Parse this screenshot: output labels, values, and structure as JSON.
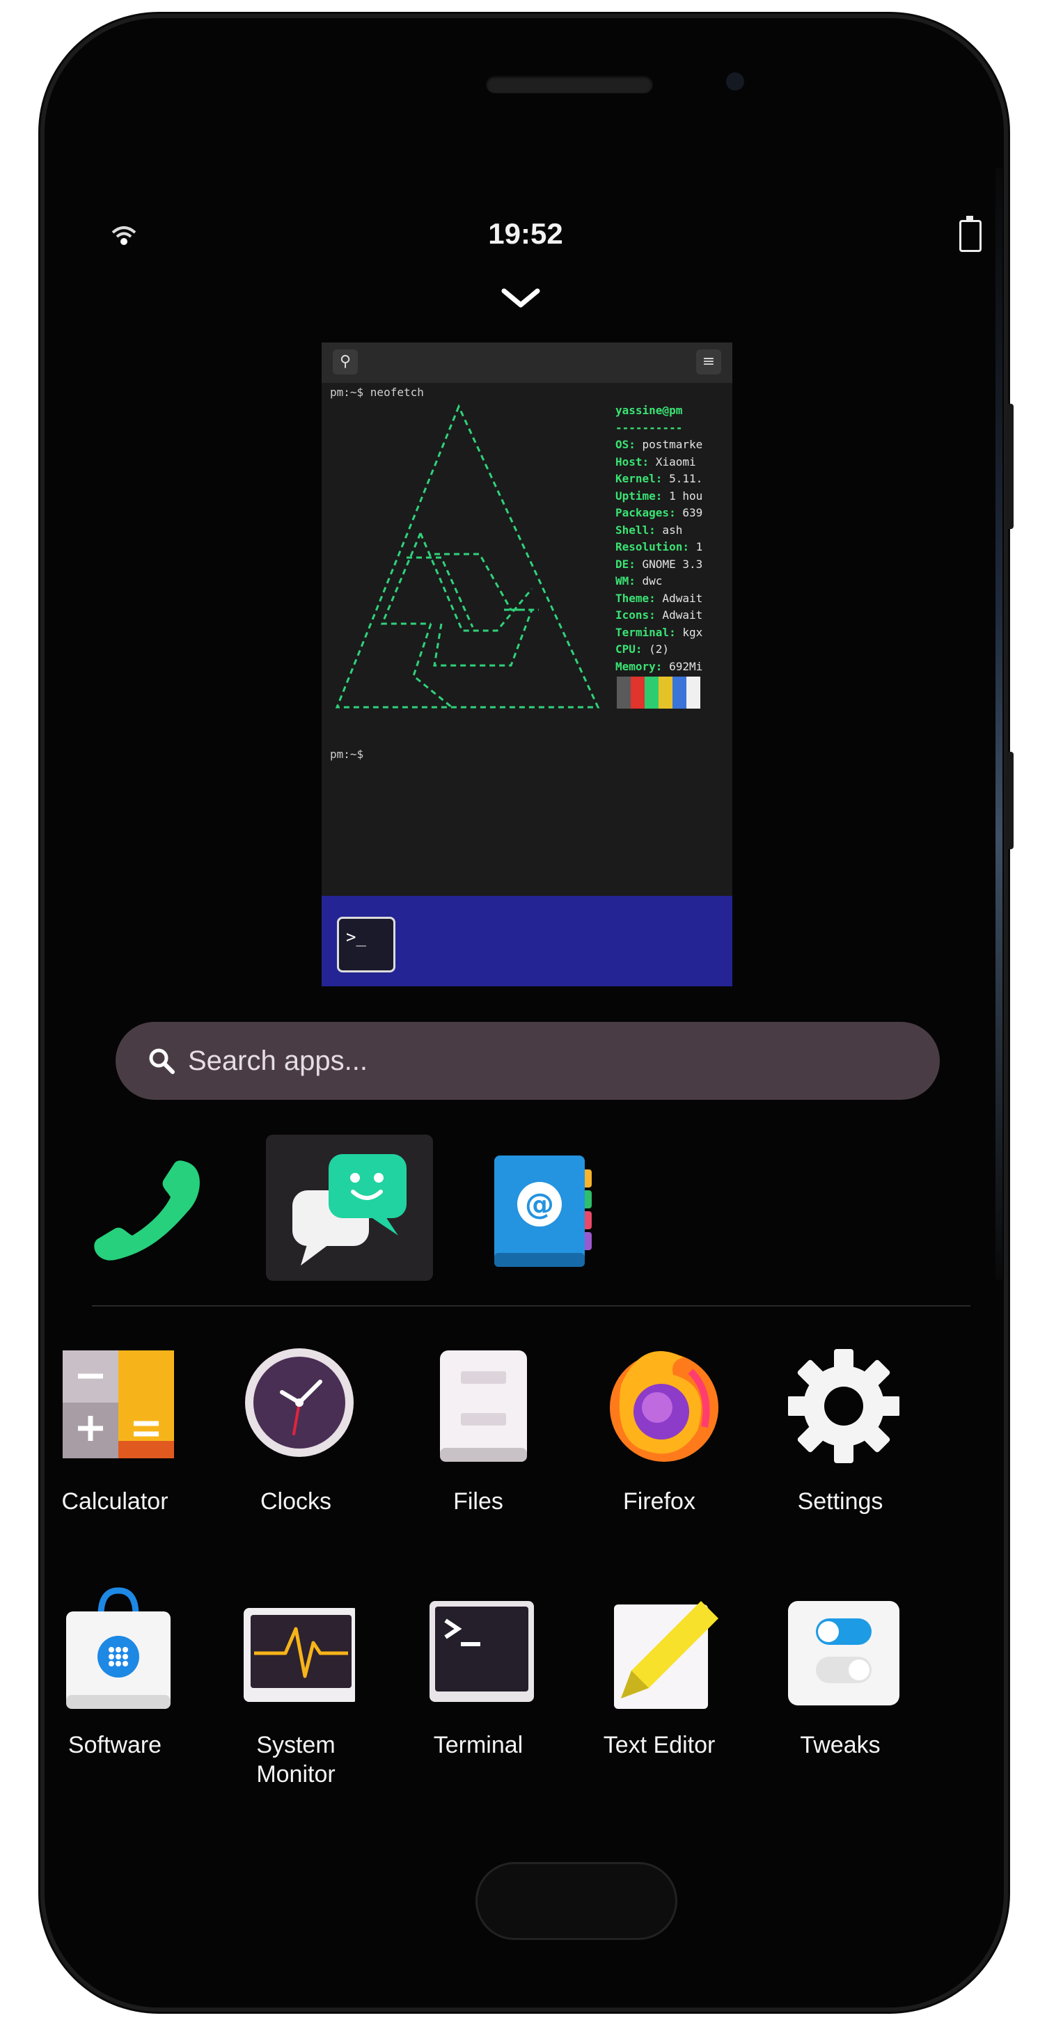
{
  "status_bar": {
    "time": "19:52",
    "wifi_icon": "wifi-icon",
    "battery_icon": "battery-icon"
  },
  "overview": {
    "collapse_icon": "chevron-down-icon"
  },
  "terminal_preview": {
    "command_line": "pm:~$ neofetch",
    "prompt_line": "pm:~$",
    "info": [
      {
        "key": "",
        "value": "yassine@pm"
      },
      {
        "key": "",
        "value": "----------"
      },
      {
        "key": "OS",
        "value": " postmarke"
      },
      {
        "key": "Host",
        "value": " Xiaomi"
      },
      {
        "key": "Kernel",
        "value": " 5.11."
      },
      {
        "key": "Uptime",
        "value": " 1 hou"
      },
      {
        "key": "Packages",
        "value": " 639"
      },
      {
        "key": "Shell",
        "value": " ash"
      },
      {
        "key": "Resolution",
        "value": " 1"
      },
      {
        "key": "DE",
        "value": " GNOME 3.3"
      },
      {
        "key": "WM",
        "value": " dwc"
      },
      {
        "key": "Theme",
        "value": " Adwait"
      },
      {
        "key": "Icons",
        "value": " Adwait"
      },
      {
        "key": "Terminal",
        "value": " kgx"
      },
      {
        "key": "CPU",
        "value": " (2)"
      },
      {
        "key": "Memory",
        "value": " 692Mi"
      }
    ],
    "palette_colors": [
      "#5a5a5a",
      "#e0342c",
      "#2ecc71",
      "#e6c229",
      "#3b74d9",
      "#f0f0f0"
    ],
    "ascii_color": "#2fd27a"
  },
  "search": {
    "placeholder": "Search apps..."
  },
  "favorites": [
    {
      "name": "phone",
      "icon": "phone-icon"
    },
    {
      "name": "chats",
      "icon": "chat-icon"
    },
    {
      "name": "contacts",
      "icon": "contacts-icon"
    }
  ],
  "apps": [
    {
      "label": "Calculator",
      "icon": "calculator-icon"
    },
    {
      "label": "Clocks",
      "icon": "clock-icon"
    },
    {
      "label": "Files",
      "icon": "files-icon"
    },
    {
      "label": "Firefox",
      "icon": "firefox-icon"
    },
    {
      "label": "Settings",
      "icon": "gear-icon"
    },
    {
      "label": "Software",
      "icon": "software-icon"
    },
    {
      "label": "System\nMonitor",
      "icon": "system-monitor-icon"
    },
    {
      "label": "Terminal",
      "icon": "terminal-icon"
    },
    {
      "label": "Text Editor",
      "icon": "text-editor-icon"
    },
    {
      "label": "Tweaks",
      "icon": "tweaks-icon"
    }
  ]
}
